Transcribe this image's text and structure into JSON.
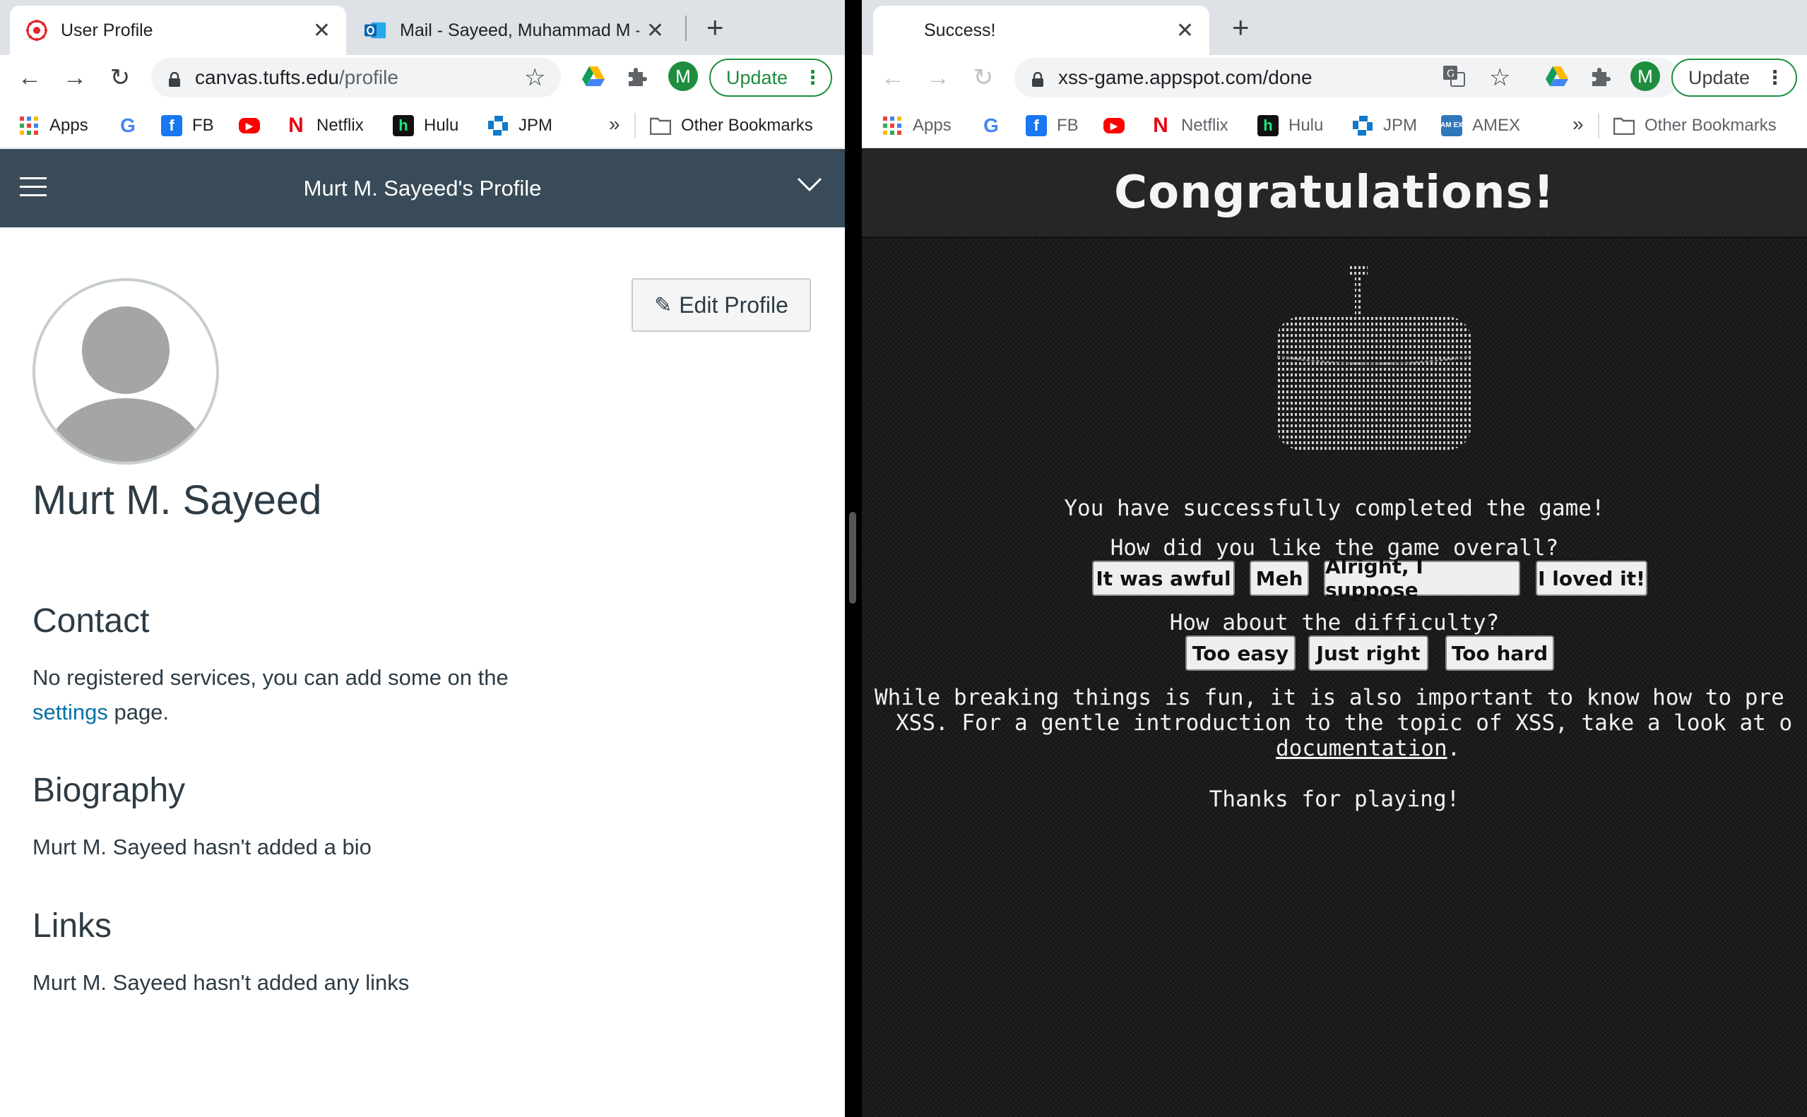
{
  "left_window": {
    "tabs": [
      {
        "title": "User Profile",
        "close": "✕"
      },
      {
        "title": "Mail - Sayeed, Muhammad M -",
        "close": "✕"
      }
    ],
    "new_tab": "+",
    "url_host": "canvas.tufts.edu",
    "url_path": "/profile",
    "avatar_letter": "M",
    "update_label": "Update",
    "update_dots": "⋮",
    "bookmarks": [
      "Apps",
      "FB",
      "Netflix",
      "Hulu",
      "JPM"
    ],
    "bookmarks_overflow": "»",
    "other_bookmarks": "Other Bookmarks",
    "header_title": "Murt M. Sayeed's Profile",
    "edit_profile": "Edit Profile",
    "profile_name": "Murt M. Sayeed",
    "contact_heading": "Contact",
    "contact_text_1": "No registered services, you can add some on the",
    "contact_link": "settings",
    "contact_text_2": " page.",
    "bio_heading": "Biography",
    "bio_text": "Murt M. Sayeed hasn't added a bio",
    "links_heading": "Links",
    "links_text": "Murt M. Sayeed hasn't added any links"
  },
  "right_window": {
    "tabs": [
      {
        "title": "Success!",
        "close": "✕"
      }
    ],
    "new_tab": "+",
    "url": "xss-game.appspot.com/done",
    "avatar_letter": "M",
    "update_label": "Update",
    "update_dots": "⋮",
    "bookmarks": [
      "Apps",
      "FB",
      "Netflix",
      "Hulu",
      "JPM",
      "AMEX"
    ],
    "bookmarks_overflow": "»",
    "other_bookmarks": "Other Bookmarks",
    "congrats": "Congratulations!",
    "completed": "You have successfully completed the game!",
    "q_overall": "How did you like the game overall?",
    "overall_options": [
      "It was awful",
      "Meh",
      "Alright, I suppose",
      "I loved it!"
    ],
    "q_difficulty": "How about the difficulty?",
    "difficulty_options": [
      "Too easy",
      "Just right",
      "Too hard"
    ],
    "closing_line_1": "While breaking things is fun, it is also important to know how to pre",
    "closing_line_2": "XSS. For a gentle introduction to the topic of XSS, take a look at o",
    "doc_link": "documentation",
    "doc_period": ".",
    "thanks": "Thanks for playing!"
  },
  "colors": {
    "canvas_header": "#394b58",
    "canvas_link": "#0770a3",
    "chrome_update_green": "#1e8e3e",
    "xss_background": "#1c1c1c"
  }
}
